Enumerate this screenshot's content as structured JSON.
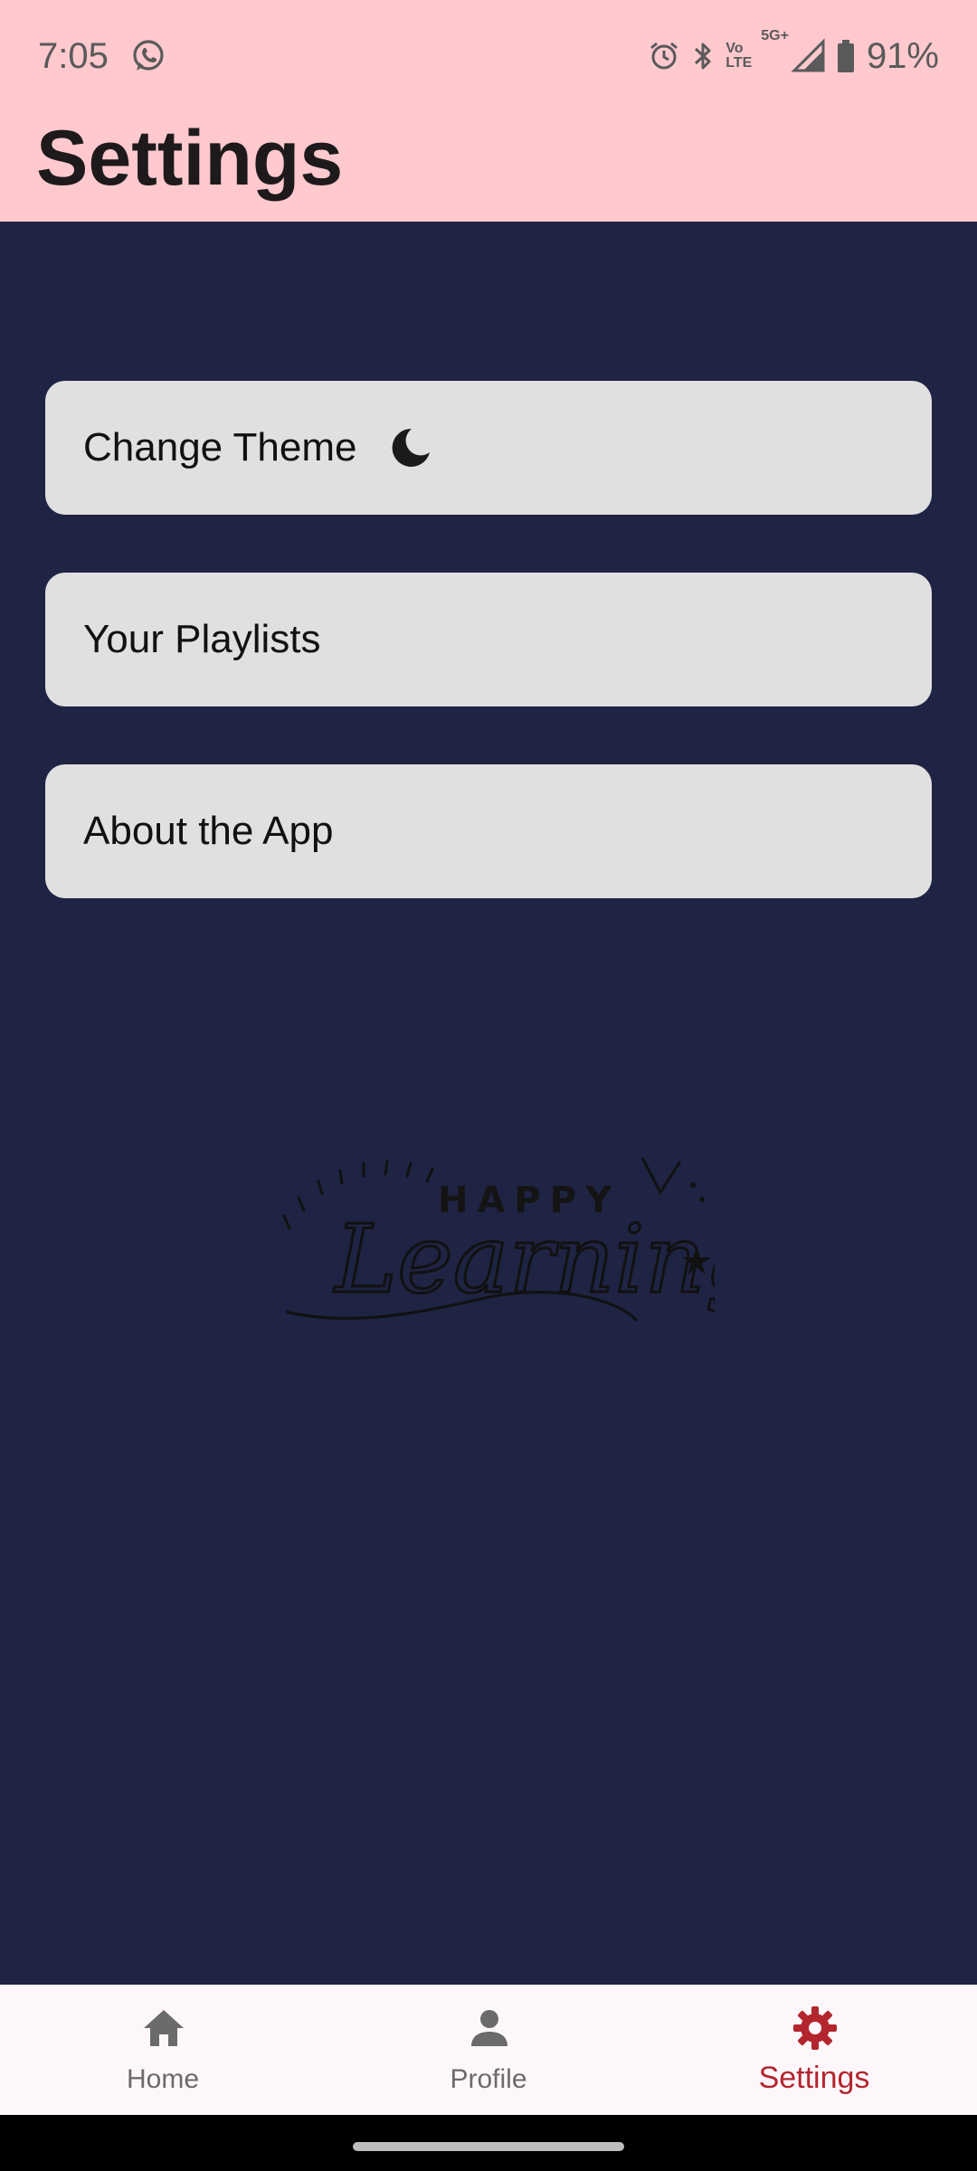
{
  "status_bar": {
    "time": "7:05",
    "network_label": "5G+",
    "volte_label_top": "Vo",
    "volte_label_bottom": "LTE",
    "battery": "91%",
    "icons": [
      "whatsapp-icon",
      "alarm-icon",
      "bluetooth-icon",
      "volte-icon",
      "signal-icon",
      "battery-icon"
    ]
  },
  "header": {
    "title": "Settings",
    "background_color": "#ffc9ce"
  },
  "menu": {
    "items": [
      {
        "label": "Change Theme",
        "icon": "moon-icon"
      },
      {
        "label": "Your Playlists"
      },
      {
        "label": "About the App"
      }
    ]
  },
  "illustration": {
    "top_text": "HAPPY",
    "script_text": "Learning"
  },
  "bottom_nav": {
    "items": [
      {
        "label": "Home",
        "icon": "home-icon",
        "active": false
      },
      {
        "label": "Profile",
        "icon": "person-icon",
        "active": false
      },
      {
        "label": "Settings",
        "icon": "gear-icon",
        "active": true
      }
    ],
    "active_color": "#b3262e",
    "inactive_color": "#6b6b6b"
  },
  "theme": {
    "page_background": "#1f2444",
    "card_background": "#e0e0e0"
  }
}
